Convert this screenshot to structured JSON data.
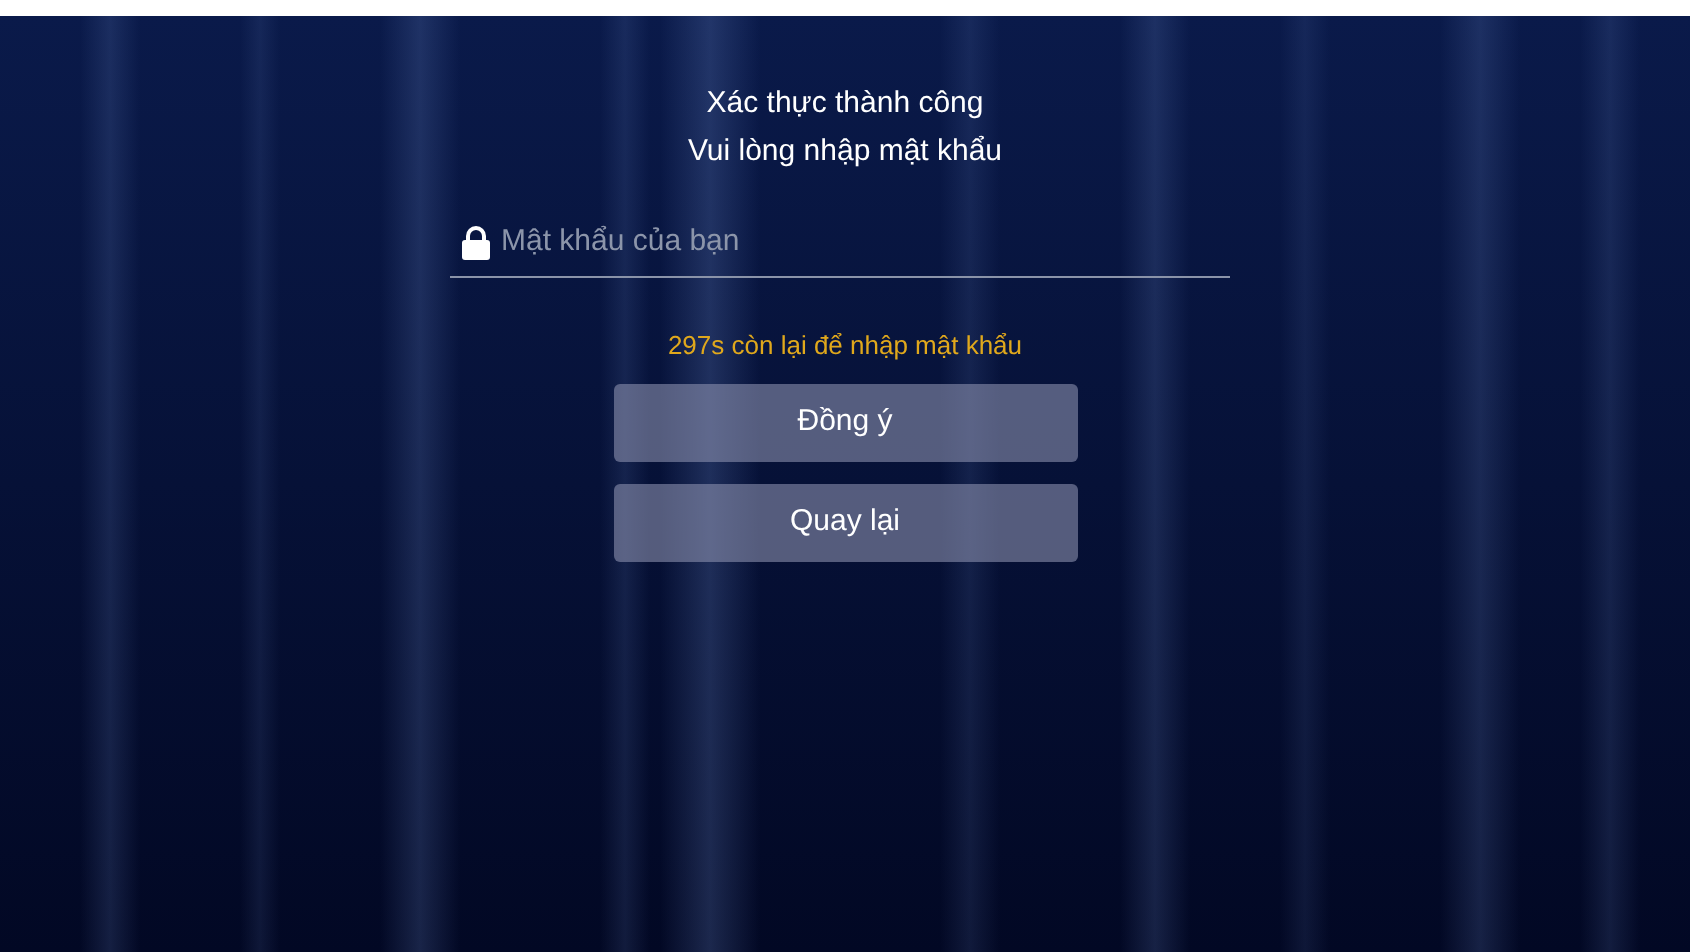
{
  "title": "Xác thực thành công",
  "subtitle": "Vui lòng nhập mật khẩu",
  "password_field": {
    "placeholder": "Mật khẩu của bạn"
  },
  "countdown": "297s còn lại để nhập mật khẩu",
  "buttons": [
    {
      "label": "Đồng ý"
    },
    {
      "label": "Quay lại"
    }
  ]
}
